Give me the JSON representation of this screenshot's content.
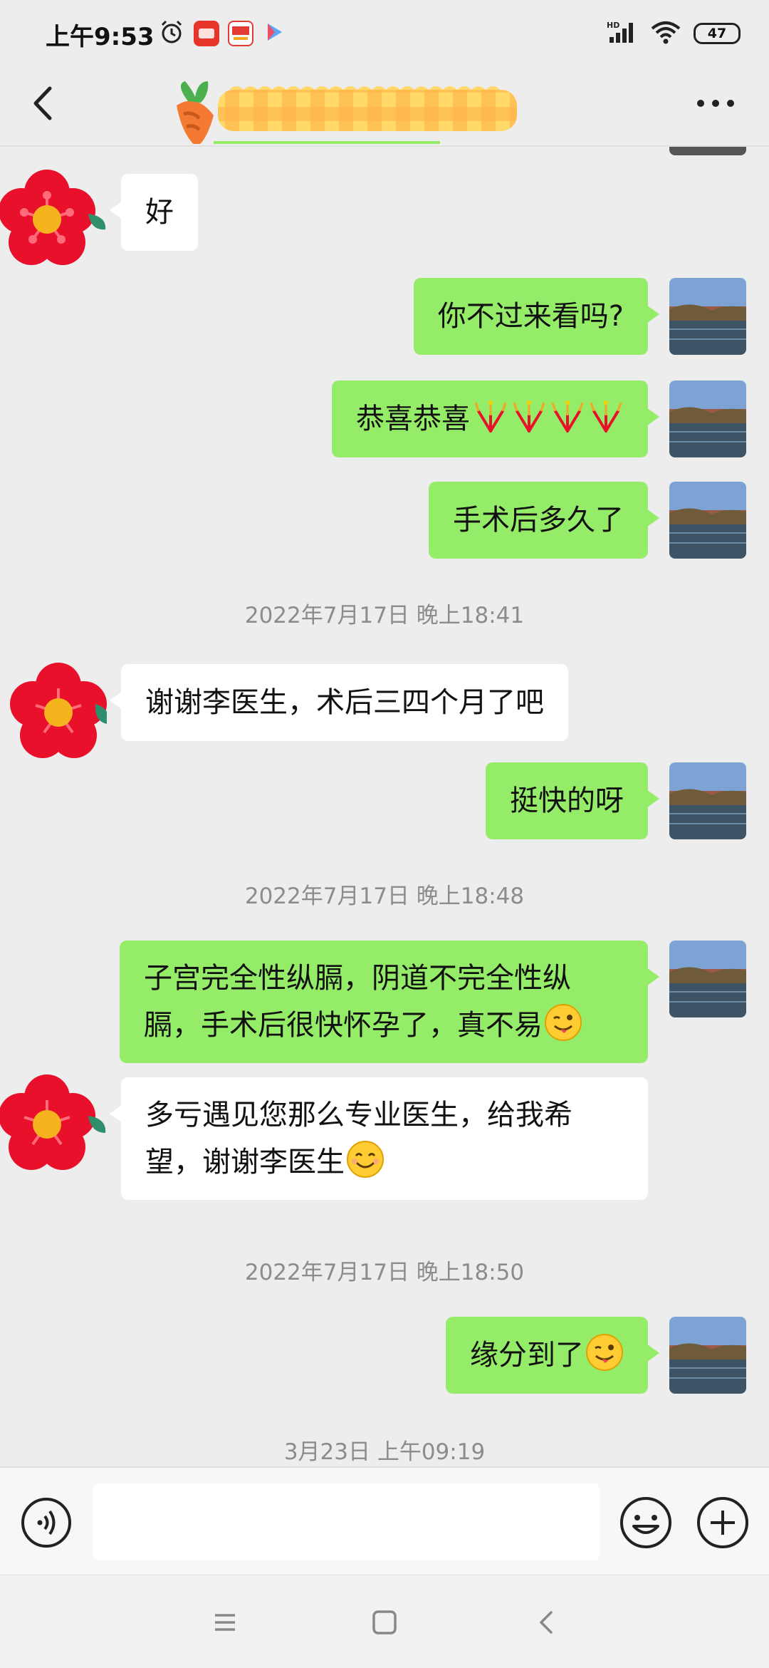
{
  "status_bar": {
    "time": "上午9:53",
    "battery": "47",
    "network": "HD",
    "app_icons": [
      "alarm-icon",
      "kan-dian-app-icon",
      "toutiao-app-icon",
      "video-app-icon"
    ]
  },
  "header": {
    "back_icon": "chevron-left-icon",
    "more_icon": "more-dots-icon",
    "title_decoration": "carrot-sticker-redaction"
  },
  "messages": [
    {
      "side": "other",
      "text": "好"
    },
    {
      "side": "self",
      "text": "你不过来看吗?"
    },
    {
      "side": "self",
      "text": "恭喜恭喜",
      "trailing": "firework-emoji x4"
    },
    {
      "side": "self",
      "text": "手术后多久了"
    },
    {
      "type": "time",
      "text": "2022年7月17日 晚上18:41"
    },
    {
      "side": "other",
      "text": "谢谢李医生，术后三四个月了吧"
    },
    {
      "side": "self",
      "text": "挺快的呀"
    },
    {
      "type": "time",
      "text": "2022年7月17日 晚上18:48"
    },
    {
      "side": "self",
      "text": "子宫完全性纵膈，阴道不完全性纵膈，手术后很快怀孕了，真不易",
      "trailing": "wink-tongue-emoji"
    },
    {
      "side": "other",
      "text": "多亏遇见您那么专业医生，给我希望，谢谢李医生",
      "trailing": "smile-emoji"
    },
    {
      "type": "time",
      "text": "2022年7月17日 晚上18:50"
    },
    {
      "side": "self",
      "text": "缘分到了",
      "trailing": "wink-tongue-emoji"
    },
    {
      "type": "time",
      "text": "3月23日 上午09:19"
    }
  ],
  "input_bar": {
    "value": "",
    "voice_icon": "voice-icon",
    "emoji_icon": "emoji-icon",
    "plus_icon": "plus-icon"
  },
  "nav_bar": {
    "buttons": [
      "menu-icon",
      "home-square-icon",
      "back-triangle-icon"
    ]
  },
  "colors": {
    "self_bubble": "#95ec69",
    "other_bubble": "#ffffff",
    "background": "#ededed",
    "timestamp": "#8c8c8c"
  }
}
